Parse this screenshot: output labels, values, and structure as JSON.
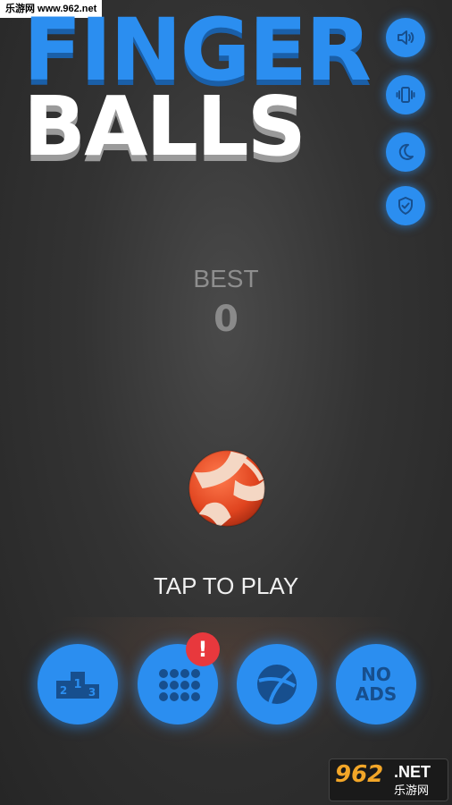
{
  "watermark_top": "乐游网 www.962.net",
  "title": {
    "line1": "FINGER",
    "line2": "BALLS"
  },
  "side_buttons": [
    {
      "name": "sound",
      "icon": "speaker-icon"
    },
    {
      "name": "vibration",
      "icon": "vibrate-icon"
    },
    {
      "name": "night-mode",
      "icon": "moon-icon"
    },
    {
      "name": "privacy",
      "icon": "shield-check-icon"
    }
  ],
  "best": {
    "label": "BEST",
    "value": "0"
  },
  "tap_to_play": "TAP TO PLAY",
  "bottom_buttons": [
    {
      "name": "leaderboard",
      "icon": "podium-icon"
    },
    {
      "name": "ball-selection",
      "icon": "grid-dots-icon",
      "badge": "!"
    },
    {
      "name": "ball-shop",
      "icon": "ball-icon"
    },
    {
      "name": "no-ads",
      "label": "NO\nADS"
    }
  ],
  "watermark_bottom": {
    "number": "962",
    "suffix": ".NET",
    "cn": "乐游网"
  },
  "colors": {
    "accent": "#2b8ef0",
    "badge": "#e8383d",
    "title_white": "#ffffff"
  }
}
